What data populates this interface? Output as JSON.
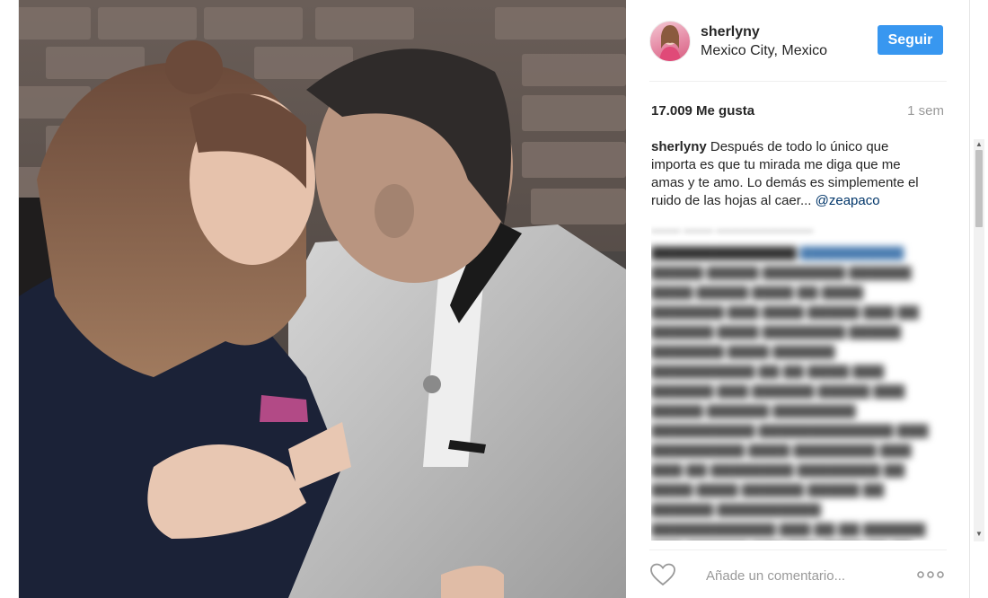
{
  "post": {
    "username": "sherlyny",
    "location": "Mexico City, Mexico",
    "follow_label": "Seguir",
    "likes": "17.009 Me gusta",
    "time_ago": "1 sem"
  },
  "caption": {
    "author": "sherlyny",
    "text": "Después de todo lo único que importa es que tu mirada me diga que me amas y te amo. Lo demás es simplemente el ruido de las hojas al caer...",
    "mention": "@zeapaco"
  },
  "footer": {
    "comment_placeholder": "Añade un comentario..."
  },
  "colors": {
    "accent": "#3897f0",
    "mention": "#003569",
    "muted": "#999999"
  },
  "icons": {
    "like": "heart-icon",
    "more": "more-options-icon"
  }
}
